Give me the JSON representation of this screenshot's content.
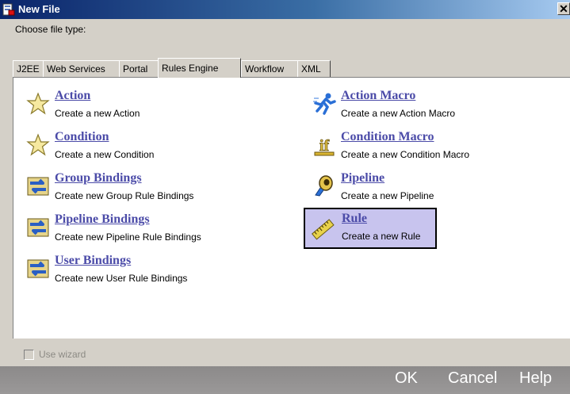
{
  "window": {
    "title": "New File",
    "close_glyph": "✕"
  },
  "prompt": "Choose file type:",
  "tabs": [
    {
      "label": "J2EE"
    },
    {
      "label": "Web Services"
    },
    {
      "label": "Portal"
    },
    {
      "label": "Rules Engine",
      "active": true
    },
    {
      "label": "Workflow"
    },
    {
      "label": "XML"
    }
  ],
  "items": [
    {
      "name": "Action",
      "desc": "Create a new Action",
      "icon": "star-icon"
    },
    {
      "name": "Action Macro",
      "desc": "Create a new Action Macro",
      "icon": "running-figure-icon"
    },
    {
      "name": "Condition",
      "desc": "Create a new Condition",
      "icon": "star-icon"
    },
    {
      "name": "Condition Macro",
      "desc": "Create a new Condition Macro",
      "icon": "if-icon"
    },
    {
      "name": "Group Bindings",
      "desc": "Create new Group Rule Bindings",
      "icon": "binding-arrows-icon"
    },
    {
      "name": "Pipeline",
      "desc": "Create a new Pipeline",
      "icon": "pipeline-icon"
    },
    {
      "name": "Pipeline Bindings",
      "desc": "Create new Pipeline Rule Bindings",
      "icon": "binding-arrows-icon"
    },
    {
      "name": "Rule",
      "desc": "Create a new Rule",
      "icon": "ruler-icon",
      "selected": true
    },
    {
      "name": "User Bindings",
      "desc": "Create new User Rule Bindings",
      "icon": "binding-arrows-icon"
    }
  ],
  "wizard": {
    "label": "Use wizard",
    "checked": false,
    "enabled": false
  },
  "buttons": {
    "ok": "OK",
    "cancel": "Cancel",
    "help": "Help"
  },
  "colors": {
    "link": "#4b4ba8",
    "selection": "#c8c4ee",
    "titlebar": "#0a246a"
  }
}
